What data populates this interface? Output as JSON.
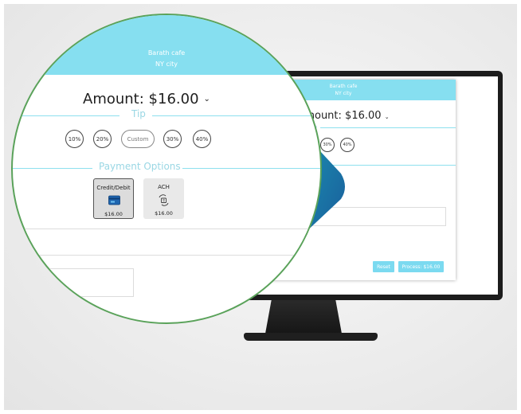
{
  "merchant": {
    "name": "Barath cafe",
    "location": "NY city"
  },
  "amount": {
    "label": "Amount:",
    "value": "$16.00"
  },
  "tip": {
    "title": "Tip",
    "options": [
      "10%",
      "20%",
      "Custom",
      "30%",
      "40%"
    ],
    "monitor_options": [
      "30%",
      "40%"
    ]
  },
  "payment": {
    "title": "Payment Options",
    "methods": [
      {
        "label": "Credit/Debit",
        "amount": "$16.00",
        "icon": "credit-card-icon",
        "selected": true
      },
      {
        "label": "ACH",
        "amount": "$16.00",
        "icon": "bank-transfer-icon",
        "selected": false
      }
    ]
  },
  "actions": {
    "reset": "Reset",
    "process": "Process: $16.00"
  },
  "colors": {
    "header": "#86dff0",
    "section": "#9ad7e4",
    "accent": "#7bdaf0",
    "border": "#5aa25a"
  }
}
